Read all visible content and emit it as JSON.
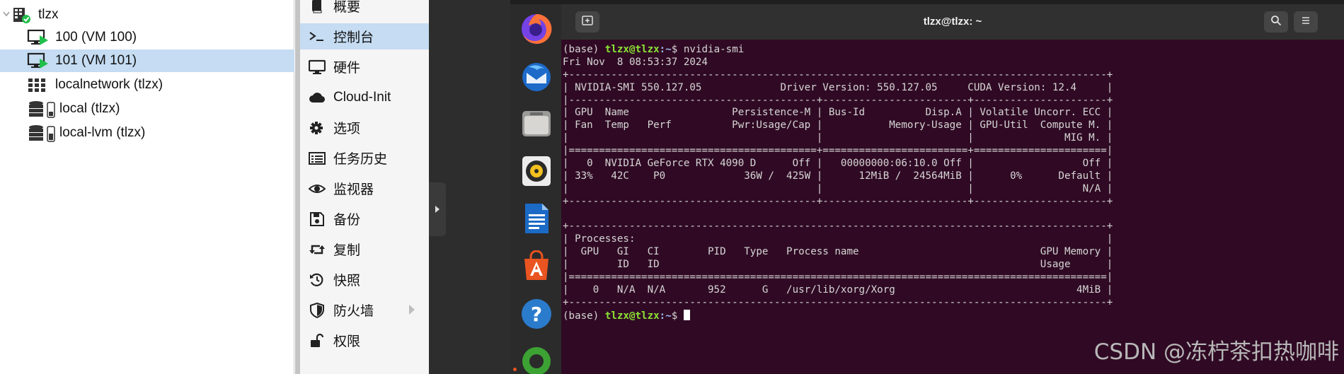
{
  "tree": {
    "node": "tlzx",
    "items": [
      {
        "label": "100 (VM 100)",
        "icon": "vm-running-icon"
      },
      {
        "label": "101 (VM 101)",
        "icon": "vm-running-icon",
        "selected": true
      },
      {
        "label": "localnetwork (tlzx)",
        "icon": "network-grid-icon"
      },
      {
        "label": "local (tlzx)",
        "icon": "storage-icon"
      },
      {
        "label": "local-lvm (tlzx)",
        "icon": "storage-icon"
      }
    ]
  },
  "menu": {
    "items": [
      {
        "label": "概要",
        "icon": "book-icon"
      },
      {
        "label": "控制台",
        "icon": "terminal-icon",
        "active": true
      },
      {
        "label": "硬件",
        "icon": "monitor-icon"
      },
      {
        "label": "Cloud-Init",
        "icon": "cloud-icon"
      },
      {
        "label": "选项",
        "icon": "gear-icon"
      },
      {
        "label": "任务历史",
        "icon": "list-icon"
      },
      {
        "label": "监视器",
        "icon": "eye-icon"
      },
      {
        "label": "备份",
        "icon": "floppy-icon"
      },
      {
        "label": "复制",
        "icon": "retweet-icon"
      },
      {
        "label": "快照",
        "icon": "history-icon"
      },
      {
        "label": "防火墙",
        "icon": "shield-icon"
      },
      {
        "label": "权限",
        "icon": "unlock-icon"
      }
    ]
  },
  "terminal": {
    "title": "tlzx@tlzx: ~",
    "prompt_env": "(base) ",
    "prompt_user": "tlzx@tlzx",
    "prompt_path": ":~",
    "prompt_end": "$ ",
    "command": "nvidia-smi",
    "date_line": "Fri Nov  8 08:53:37 2024",
    "lines": [
      "+-----------------------------------------------------------------------------------------+",
      "| NVIDIA-SMI 550.127.05             Driver Version: 550.127.05     CUDA Version: 12.4     |",
      "|-----------------------------------------+------------------------+----------------------+",
      "| GPU  Name                 Persistence-M | Bus-Id          Disp.A | Volatile Uncorr. ECC |",
      "| Fan  Temp   Perf          Pwr:Usage/Cap |           Memory-Usage | GPU-Util  Compute M. |",
      "|                                         |                        |               MIG M. |",
      "|=========================================+========================+======================|",
      "|   0  NVIDIA GeForce RTX 4090 D      Off |   00000000:06:10.0 Off |                  Off |",
      "| 33%   42C    P0             36W /  425W |      12MiB /  24564MiB |      0%      Default |",
      "|                                         |                        |                  N/A |",
      "+-----------------------------------------+------------------------+----------------------+",
      "",
      "+-----------------------------------------------------------------------------------------+",
      "| Processes:                                                                              |",
      "|  GPU   GI   CI        PID   Type   Process name                              GPU Memory |",
      "|        ID   ID                                                               Usage      |",
      "|=========================================================================================|",
      "|    0   N/A  N/A       952      G   /usr/lib/xorg/Xorg                              4MiB |",
      "+-----------------------------------------------------------------------------------------+"
    ]
  },
  "watermark": "CSDN @冻柠茶扣热咖啡",
  "colors": {
    "selection": "#c5dcf2",
    "terminal_bg": "#300a24",
    "prompt_green": "#8ae234",
    "prompt_blue": "#9fb8ef",
    "dock_bg": "#2b2b2b",
    "running_indicator": "#e95420"
  }
}
